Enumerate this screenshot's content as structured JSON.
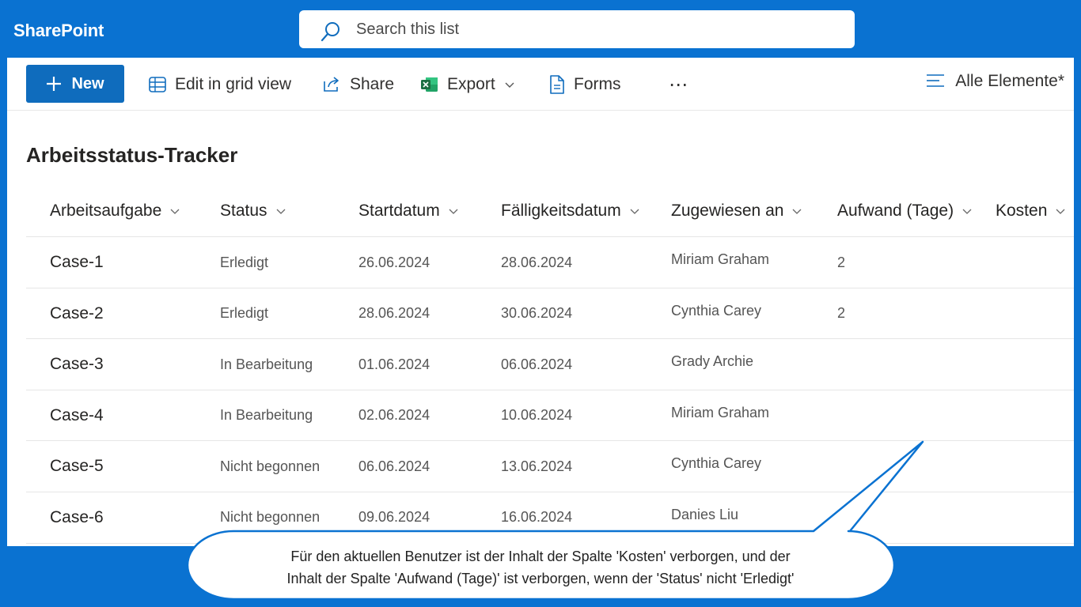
{
  "app": {
    "title": "SharePoint"
  },
  "search": {
    "placeholder": "Search this list"
  },
  "toolbar": {
    "new_label": "New",
    "grid_label": "Edit in grid view",
    "share_label": "Share",
    "export_label": "Export",
    "forms_label": "Forms",
    "more_label": "⋯",
    "view_label": "Alle Elemente*"
  },
  "list": {
    "title": "Arbeitsstatus-Tracker",
    "columns": [
      "Arbeitsaufgabe",
      "Status",
      "Startdatum",
      "Fälligkeitsdatum",
      "Zugewiesen an",
      "Aufwand (Tage)",
      "Kosten"
    ],
    "rows": [
      {
        "task": "Case-1",
        "status": "Erledigt",
        "start": "26.06.2024",
        "due": "28.06.2024",
        "assigned": "Miriam Graham",
        "effort": "2",
        "cost": ""
      },
      {
        "task": "Case-2",
        "status": "Erledigt",
        "start": "28.06.2024",
        "due": "30.06.2024",
        "assigned": "Cynthia Carey",
        "effort": "2",
        "cost": ""
      },
      {
        "task": "Case-3",
        "status": "In Bearbeitung",
        "start": "01.06.2024",
        "due": "06.06.2024",
        "assigned": "Grady Archie",
        "effort": "",
        "cost": ""
      },
      {
        "task": "Case-4",
        "status": "In Bearbeitung",
        "start": "02.06.2024",
        "due": "10.06.2024",
        "assigned": "Miriam Graham",
        "effort": "",
        "cost": ""
      },
      {
        "task": "Case-5",
        "status": "Nicht begonnen",
        "start": "06.06.2024",
        "due": "13.06.2024",
        "assigned": "Cynthia Carey",
        "effort": "",
        "cost": ""
      },
      {
        "task": "Case-6",
        "status": "Nicht begonnen",
        "start": "09.06.2024",
        "due": "16.06.2024",
        "assigned": "Danies Liu",
        "effort": "",
        "cost": ""
      }
    ]
  },
  "callout": {
    "line1": "Für den aktuellen Benutzer ist der Inhalt der Spalte 'Kosten' verborgen, und der",
    "line2": "Inhalt der Spalte 'Aufwand (Tage)' ist verborgen, wenn der 'Status' nicht 'Erledigt'"
  },
  "colors": {
    "brand": "#0a72d1",
    "button": "#0f6cbd",
    "excel": "#1d6f42"
  }
}
